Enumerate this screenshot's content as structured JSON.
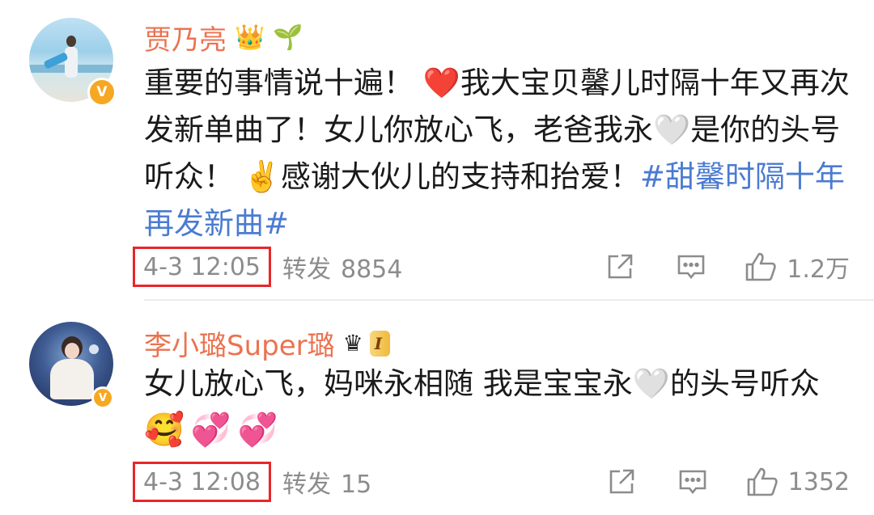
{
  "posts": [
    {
      "username": "贾乃亮",
      "badges": [
        "👑",
        "🌱"
      ],
      "text_before": "重要的事情说十遍！ ❤️我大宝贝馨儿时隔十年又再次发新单曲了！女儿你放心飞，老爸我永🤍是你的头号听众！ ✌️感谢大伙儿的支持和抬爱！",
      "hashtag": "#甜馨时隔十年再发新曲#",
      "timestamp": "4-3 12:05",
      "repost_label": "转发",
      "repost_count": "8854",
      "like_count": "1.2万"
    },
    {
      "username": "李小璐Super璐",
      "vip_level": "I",
      "text_before": "女儿放心飞，妈咪永相随 我是宝宝永🤍的头号听众",
      "emojis": "🥰💞💞",
      "timestamp": "4-3 12:08",
      "repost_label": "转发",
      "repost_count": "15",
      "like_count": "1352"
    }
  ],
  "icons": {
    "share": "share-icon",
    "comment": "comment-icon",
    "like": "thumbs-up-icon",
    "verified": "verified-v-icon"
  },
  "colors": {
    "username": "#eb7350",
    "hashtag": "#4b7bd1",
    "meta": "#8c8c8c",
    "highlight_box": "#e8262a"
  },
  "verified_label": "V"
}
